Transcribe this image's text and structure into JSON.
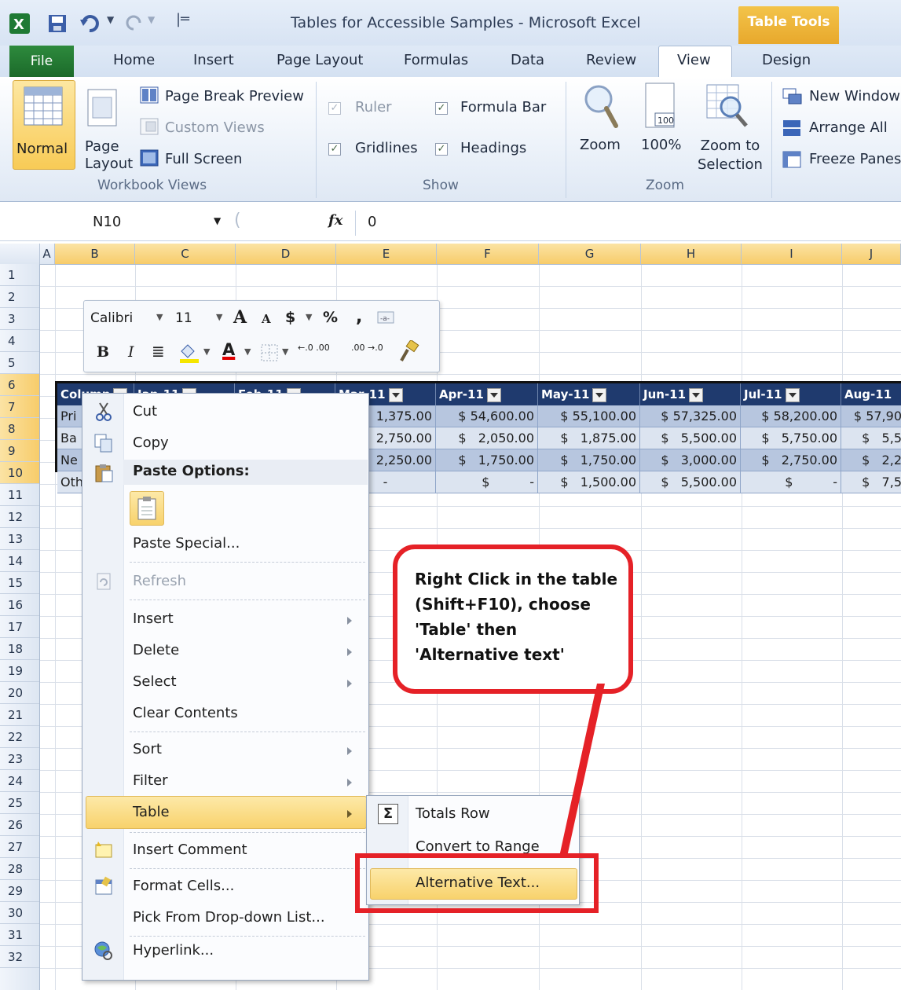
{
  "window": {
    "title": "Tables for Accessible Samples  -  Microsoft Excel",
    "context_tab_group": "Table Tools"
  },
  "tabs": [
    "File",
    "Home",
    "Insert",
    "Page Layout",
    "Formulas",
    "Data",
    "Review",
    "View",
    "Design"
  ],
  "ribbon": {
    "workbook_views": {
      "label": "Workbook Views",
      "normal": "Normal",
      "page_layout_line1": "Page",
      "page_layout_line2": "Layout",
      "page_break_preview": "Page Break Preview",
      "custom_views": "Custom Views",
      "full_screen": "Full Screen"
    },
    "show": {
      "label": "Show",
      "ruler": "Ruler",
      "formula_bar": "Formula Bar",
      "gridlines": "Gridlines",
      "headings": "Headings"
    },
    "zoom": {
      "label": "Zoom",
      "zoom": "Zoom",
      "hundred": "100%",
      "hundred_icon": "100",
      "zoom_to_line1": "Zoom to",
      "zoom_to_line2": "Selection"
    },
    "window": {
      "new_window": "New Window",
      "arrange_all": "Arrange All",
      "freeze_panes": "Freeze Panes"
    }
  },
  "formula_bar": {
    "name_box": "N10",
    "fx": "fx",
    "value": "0"
  },
  "grid": {
    "columns": [
      "A",
      "B",
      "C",
      "D",
      "E",
      "F",
      "G",
      "H",
      "I",
      "J"
    ],
    "rows": [
      "1",
      "2",
      "3",
      "4",
      "5",
      "6",
      "7",
      "8",
      "9",
      "10",
      "11",
      "12",
      "13",
      "14",
      "15",
      "16",
      "17",
      "18",
      "19",
      "20",
      "21",
      "22",
      "23",
      "24",
      "25",
      "26",
      "27",
      "28",
      "29",
      "30",
      "31",
      "32"
    ]
  },
  "table": {
    "headers": [
      "Column",
      "Jan-11",
      "Feb-11",
      "Mar-11",
      "Apr-11",
      "May-11",
      "Jun-11",
      "Jul-11",
      "Aug-11"
    ],
    "row_labels": [
      "Pri",
      "Ba",
      "Ne",
      "Oth"
    ],
    "rows": [
      [
        "1,375.00",
        "$ 54,600.00",
        "$ 55,100.00",
        "$ 57,325.00",
        "$ 58,200.00",
        "$ 57,90"
      ],
      [
        "2,750.00",
        "$   2,050.00",
        "$   1,875.00",
        "$   5,500.00",
        "$   5,750.00",
        "$   5,5"
      ],
      [
        "2,250.00",
        "$   1,750.00",
        "$   1,750.00",
        "$   3,000.00",
        "$   2,750.00",
        "$   2,2"
      ],
      [
        "-",
        "$          -",
        "$   1,500.00",
        "$   5,500.00",
        "$          -",
        "$   7,5"
      ]
    ]
  },
  "mini_toolbar": {
    "font": "Calibri",
    "size": "11",
    "grow": "A",
    "shrink": "A",
    "currency": "$",
    "percent": "%",
    "comma": ",",
    "bold": "B",
    "italic": "I",
    "font_color": "A",
    "inc_decimal": "←.0 .00",
    "dec_decimal": ".00 →.0"
  },
  "context_menu": {
    "cut": "Cut",
    "copy": "Copy",
    "paste_options": "Paste Options:",
    "paste_special": "Paste Special...",
    "refresh": "Refresh",
    "insert": "Insert",
    "delete": "Delete",
    "select": "Select",
    "clear_contents": "Clear Contents",
    "sort": "Sort",
    "filter": "Filter",
    "table": "Table",
    "insert_comment": "Insert Comment",
    "format_cells": "Format Cells...",
    "pick_from_list": "Pick From Drop-down List...",
    "hyperlink": "Hyperlink..."
  },
  "submenu": {
    "totals_row": "Totals Row",
    "convert_to_range": "Convert to Range",
    "alternative_text": "Alternative Text..."
  },
  "callout": {
    "line1": "Right Click in the table",
    "line2": "(Shift+F10), choose",
    "line3": "'Table' then",
    "line4": "'Alternative text'"
  },
  "colors": {
    "accent_red": "#e52127",
    "table_header": "#1f3a6e",
    "table_band": "#b7c6df",
    "highlight": "#f8d26c"
  }
}
